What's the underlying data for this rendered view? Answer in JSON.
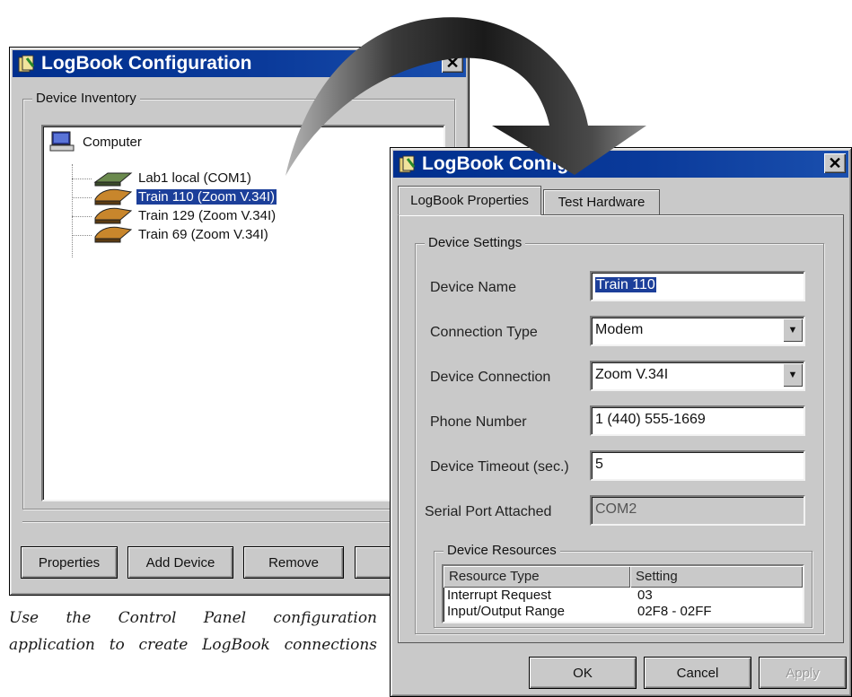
{
  "colors": {
    "titlebar": "#002f8e",
    "selection": "#1c3f9a",
    "window_bg": "#c9c9c9"
  },
  "back_window": {
    "title": "LogBook Configuration",
    "close_icon": "close-icon",
    "group_label": "Device Inventory",
    "tree": {
      "root": "Computer",
      "children": [
        {
          "label": "Lab1 local (COM1)",
          "selected": false
        },
        {
          "label": "Train 110 (Zoom V.34I)",
          "selected": true
        },
        {
          "label": "Train 129 (Zoom V.34I)",
          "selected": false
        },
        {
          "label": "Train 69 (Zoom V.34I)",
          "selected": false
        }
      ]
    },
    "buttons": {
      "properties": "Properties",
      "add_device": "Add Device",
      "remove": "Remove",
      "partial": "("
    }
  },
  "front_window": {
    "title": "LogBook Configu",
    "tabs": [
      "LogBook Properties",
      "Test Hardware"
    ],
    "group_label": "Device Settings",
    "fields": {
      "device_name": {
        "label": "Device Name",
        "value": "Train 110"
      },
      "connection_type": {
        "label": "Connection Type",
        "value": "Modem"
      },
      "device_connection": {
        "label": "Device Connection",
        "value": "Zoom V.34I"
      },
      "phone_number": {
        "label": "Phone Number",
        "value": "1 (440) 555-1669"
      },
      "device_timeout": {
        "label": "Device Timeout (sec.)",
        "value": "5"
      },
      "serial_port": {
        "label": "Serial Port Attached",
        "value": "COM2"
      }
    },
    "resources": {
      "label": "Device Resources",
      "columns": [
        "Resource Type",
        "Setting"
      ],
      "rows": [
        {
          "type": "Interrupt Request",
          "setting": "03"
        },
        {
          "type": "Input/Output Range",
          "setting": "02F8 - 02FF"
        }
      ]
    },
    "buttons": {
      "ok": "OK",
      "cancel": "Cancel",
      "apply": "Apply"
    }
  },
  "caption": "Use the Control Panel configuration application to create LogBook connections"
}
